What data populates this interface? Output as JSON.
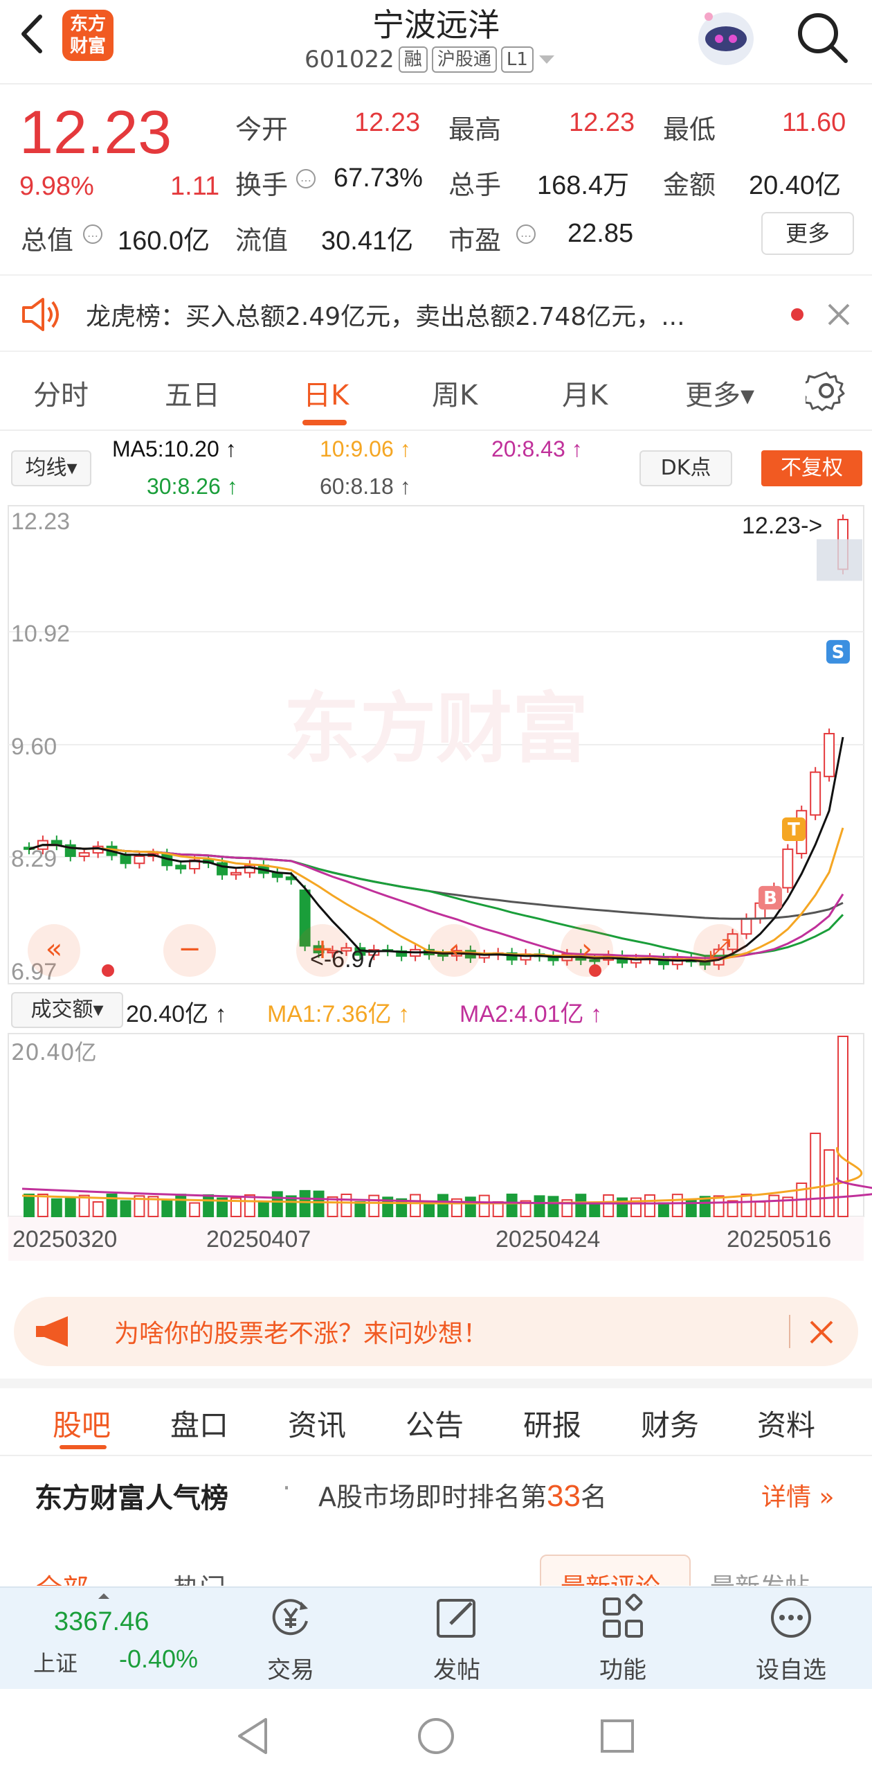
{
  "header": {
    "logo_line1": "东方",
    "logo_line2": "财富",
    "stock_name": "宁波远洋",
    "stock_code": "601022",
    "tags": [
      "融",
      "沪股通",
      "L1"
    ]
  },
  "quote": {
    "price": "12.23",
    "change_pct": "9.98%",
    "change_amt": "1.11",
    "fields": [
      {
        "label": "今开",
        "value": "12.23"
      },
      {
        "label": "最高",
        "value": "12.23"
      },
      {
        "label": "最低",
        "value": "11.60"
      },
      {
        "label": "换手",
        "value": "67.73%"
      },
      {
        "label": "总手",
        "value": "168.4万"
      },
      {
        "label": "金额",
        "value": "20.40亿"
      },
      {
        "label": "总值",
        "value": "160.0亿"
      },
      {
        "label": "流值",
        "value": "30.41亿"
      },
      {
        "label": "市盈",
        "value": "22.85"
      }
    ],
    "more_label": "更多"
  },
  "news": {
    "text": "龙虎榜：买入总额2.49亿元，卖出总额2.748亿元，..."
  },
  "kline_tabs": [
    "分时",
    "五日",
    "日K",
    "周K",
    "月K",
    "更多▾"
  ],
  "indicators": {
    "ma_button": "均线▾",
    "ma5": "MA5:10.20 ↑",
    "ma10": "10:9.06 ↑",
    "ma20": "20:8.43 ↑",
    "ma30": "30:8.26 ↑",
    "ma60": "60:8.18 ↑",
    "dk_button": "DK点",
    "fq_button": "不复权"
  },
  "chart_data": {
    "type": "candlestick",
    "price_axis_labels": [
      "12.23",
      "10.92",
      "9.60",
      "8.29",
      "6.97"
    ],
    "ylim": [
      6.97,
      12.23
    ],
    "last_price_marker": "12.23->",
    "low_marker": "<-6.97",
    "signal_markers": [
      "S",
      "T",
      "B"
    ],
    "volume_selector": "成交额▾",
    "volume_value": "20.40亿 ↑",
    "vol_ma1": "MA1:7.36亿 ↑",
    "vol_ma2": "MA2:4.01亿 ↑",
    "volume_axis_label": "20.40亿",
    "date_labels": [
      "20250320",
      "20250407",
      "20250424",
      "20250516"
    ]
  },
  "ad": {
    "text": "为啥你的股票老不涨？来问妙想！"
  },
  "bottom_tabs": [
    "股吧",
    "盘口",
    "资讯",
    "公告",
    "研报",
    "财务",
    "资料"
  ],
  "ranking": {
    "title": "东方财富人气榜",
    "text_before": "A股市场即时排名第",
    "rank": "33",
    "text_after": "名",
    "detail": "详情"
  },
  "sub_tabs": [
    "全部",
    "热门",
    "最新评论",
    "最新发帖"
  ],
  "toolbar": {
    "index_value": "3367.46",
    "index_name": "上证",
    "index_change": "-0.40%",
    "items": [
      "交易",
      "发帖",
      "功能",
      "设自选"
    ]
  },
  "colors": {
    "accent": "#f15a22",
    "up": "#e4393c",
    "down": "#1a9e3a",
    "ma5": "#111111",
    "ma10": "#f5a623",
    "ma20": "#c0309a",
    "ma30": "#1a9e3a",
    "ma60": "#555555"
  }
}
